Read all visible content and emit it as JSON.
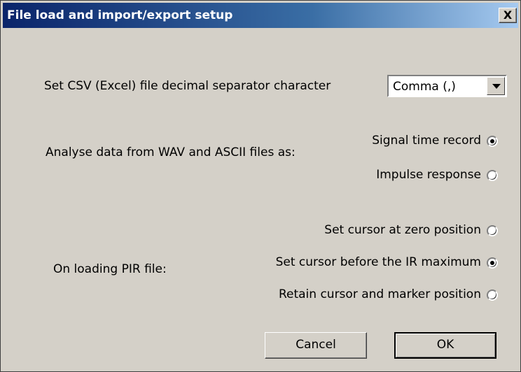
{
  "window": {
    "title": "File load and import/export setup",
    "close_label": "X"
  },
  "csv": {
    "label": "Set CSV (Excel) file decimal separator character",
    "selected": "Comma (,)"
  },
  "analyse": {
    "label": "Analyse data from WAV and ASCII files as:",
    "options": [
      {
        "label": "Signal time record",
        "checked": true
      },
      {
        "label": "Impulse response",
        "checked": false
      }
    ]
  },
  "pir": {
    "label": "On loading PIR file:",
    "options": [
      {
        "label": "Set cursor at zero position",
        "checked": false
      },
      {
        "label": "Set cursor before the IR maximum",
        "checked": true
      },
      {
        "label": "Retain cursor and marker position",
        "checked": false
      }
    ]
  },
  "buttons": {
    "cancel": "Cancel",
    "ok": "OK"
  }
}
